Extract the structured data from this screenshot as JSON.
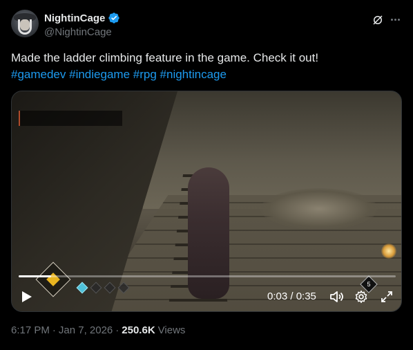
{
  "author": {
    "display_name": "NightinCage",
    "handle": "@NightinCage",
    "verified": true
  },
  "post": {
    "text": "Made the ladder climbing feature in the game. Check it out!",
    "hashtags": [
      "#gamedev",
      "#indiegame",
      "#rpg",
      "#nightincage"
    ]
  },
  "video": {
    "time_label": "0:03 / 0:35",
    "progress_fraction": 0.0857,
    "hud_badge": "5"
  },
  "meta": {
    "time": "6:17 PM",
    "separator": "·",
    "date": "Jan 7, 2026",
    "views_count": "250.6K",
    "views_label": "Views"
  },
  "colors": {
    "accent": "#1d9bf0",
    "text_primary": "#e7e9ea",
    "text_secondary": "#71767b",
    "background": "#000000"
  },
  "icons": {
    "verified": "verified-badge-icon",
    "grok": "grok-icon",
    "more": "more-icon",
    "play": "play-icon",
    "volume": "volume-icon",
    "settings": "gear-icon",
    "fullscreen": "fullscreen-icon"
  }
}
